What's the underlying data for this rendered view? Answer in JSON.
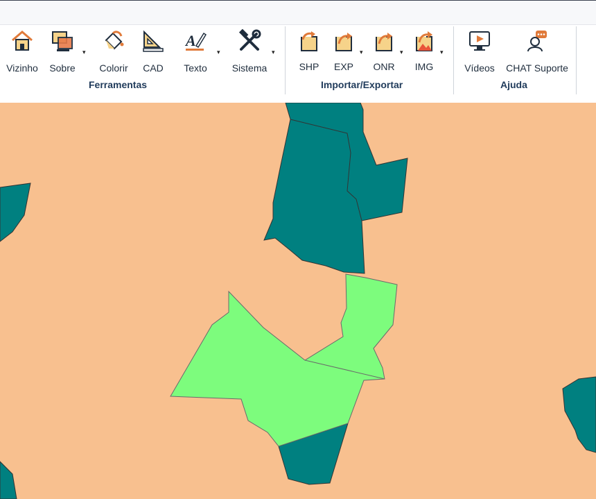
{
  "toolbar": {
    "groups": [
      {
        "label": "Ferramentas",
        "tools": [
          {
            "label": "Vizinho",
            "icon": "house-neighbor-icon"
          },
          {
            "label": "Sobre",
            "icon": "overlap-layers-icon"
          },
          {
            "label": "Colorir",
            "icon": "paint-bucket-icon"
          },
          {
            "label": "CAD",
            "icon": "set-square-ruler-icon"
          },
          {
            "label": "Texto",
            "icon": "text-pen-icon"
          },
          {
            "label": "Sistema",
            "icon": "wrench-hammer-icon"
          }
        ]
      },
      {
        "label": "Importar/Exportar",
        "tools": [
          {
            "label": "SHP",
            "icon": "shp-import-icon"
          },
          {
            "label": "EXP",
            "icon": "exp-export-icon"
          },
          {
            "label": "ONR",
            "icon": "onr-export-icon"
          },
          {
            "label": "IMG",
            "icon": "img-export-icon"
          }
        ]
      },
      {
        "label": "Ajuda",
        "tools": [
          {
            "label": "Vídeos",
            "icon": "video-monitor-icon"
          },
          {
            "label": "CHAT Suporte",
            "icon": "chat-support-icon"
          }
        ]
      }
    ],
    "dropdown_symbol": "▾"
  },
  "map": {
    "colors": {
      "background": "#f8c08f",
      "neighbor_parcel": "#008080",
      "selected_parcel": "#7dfc7d",
      "outline": "#333333"
    }
  }
}
